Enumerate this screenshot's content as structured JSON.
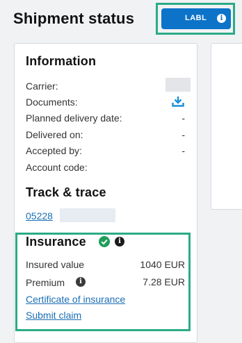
{
  "page": {
    "title": "Shipment status"
  },
  "label_button": {
    "label": "LABL",
    "icon": "info-icon"
  },
  "information": {
    "heading": "Information",
    "rows": [
      {
        "label": "Carrier:",
        "value": ""
      },
      {
        "label": "Documents:",
        "value": ""
      },
      {
        "label": "Planned delivery date:",
        "value": "-"
      },
      {
        "label": "Delivered on:",
        "value": "-"
      },
      {
        "label": "Accepted by:",
        "value": "-"
      },
      {
        "label": "Account code:",
        "value": ""
      }
    ]
  },
  "track": {
    "heading": "Track & trace",
    "number_visible": "05228"
  },
  "insurance": {
    "heading": "Insurance",
    "insured_label": "Insured value",
    "insured_value": "1040 EUR",
    "premium_label": "Premium",
    "premium_value": "7.28 EUR",
    "certificate_link": "Certificate of insurance",
    "claim_link": "Submit claim"
  },
  "colors": {
    "accent": "#0d73c9",
    "highlight": "#2bab86",
    "link": "#1a6fb5",
    "success": "#1e9e5a"
  }
}
